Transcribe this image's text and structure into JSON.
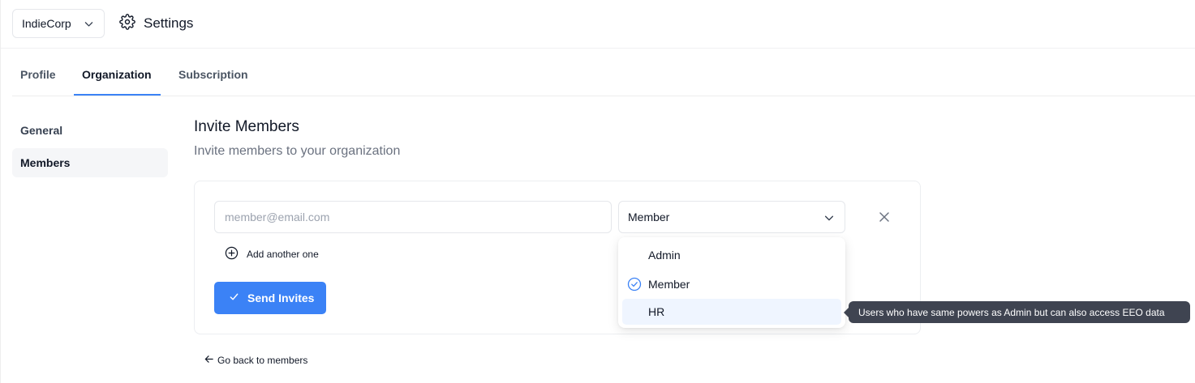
{
  "header": {
    "org_name": "IndieCorp",
    "settings_title": "Settings"
  },
  "tabs": [
    {
      "label": "Profile"
    },
    {
      "label": "Organization"
    },
    {
      "label": "Subscription"
    }
  ],
  "active_tab": "Organization",
  "sidebar": {
    "items": [
      {
        "label": "General"
      },
      {
        "label": "Members"
      }
    ],
    "active": "Members"
  },
  "invite": {
    "title": "Invite Members",
    "subtitle": "Invite members to your organization",
    "email_placeholder": "member@email.com",
    "email_value": "",
    "selected_role": "Member",
    "add_another_label": "Add another one",
    "send_label": "Send Invites",
    "back_label": "Go back to members"
  },
  "role_options": [
    {
      "label": "Admin"
    },
    {
      "label": "Member"
    },
    {
      "label": "HR"
    }
  ],
  "tooltip": {
    "text": "Users who have same powers as Admin but can also access EEO data"
  },
  "colors": {
    "accent": "#3b82f6",
    "tooltip_bg": "#3f4451",
    "hover_bg": "#eff5ff"
  },
  "icons": {
    "settings": "gear-icon",
    "chevron": "chevron-down-icon",
    "remove": "close-icon",
    "add": "plus-circle-icon",
    "send": "check-icon",
    "back": "arrow-left-icon",
    "selected": "check-circle-icon"
  }
}
